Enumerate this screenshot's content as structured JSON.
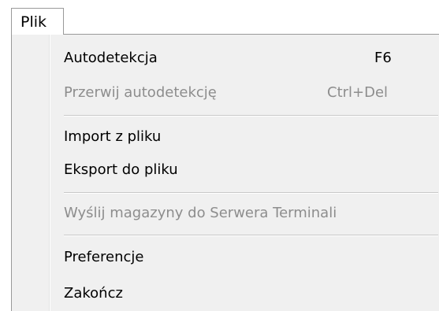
{
  "menubar": {
    "active_menu_label": "Plik"
  },
  "menu": {
    "items": [
      {
        "label": "Autodetekcja",
        "shortcut": "F6",
        "enabled": true
      },
      {
        "label": "Przerwij autodetekcję",
        "shortcut": "Ctrl+Del",
        "enabled": false
      },
      {
        "label": "Import z pliku",
        "shortcut": "",
        "enabled": true
      },
      {
        "label": "Eksport do pliku",
        "shortcut": "",
        "enabled": true
      },
      {
        "label": "Wyślij magazyny do Serwera Terminali",
        "shortcut": "",
        "enabled": false
      },
      {
        "label": "Preferencje",
        "shortcut": "",
        "enabled": true
      },
      {
        "label": "Zakończ",
        "shortcut": "",
        "enabled": true
      }
    ]
  },
  "colors": {
    "menu_background": "#f0f0f0",
    "enabled_text": "#000000",
    "disabled_text": "#8d8d8d",
    "separator": "#c8c8c8",
    "border": "#9a9a9a"
  }
}
